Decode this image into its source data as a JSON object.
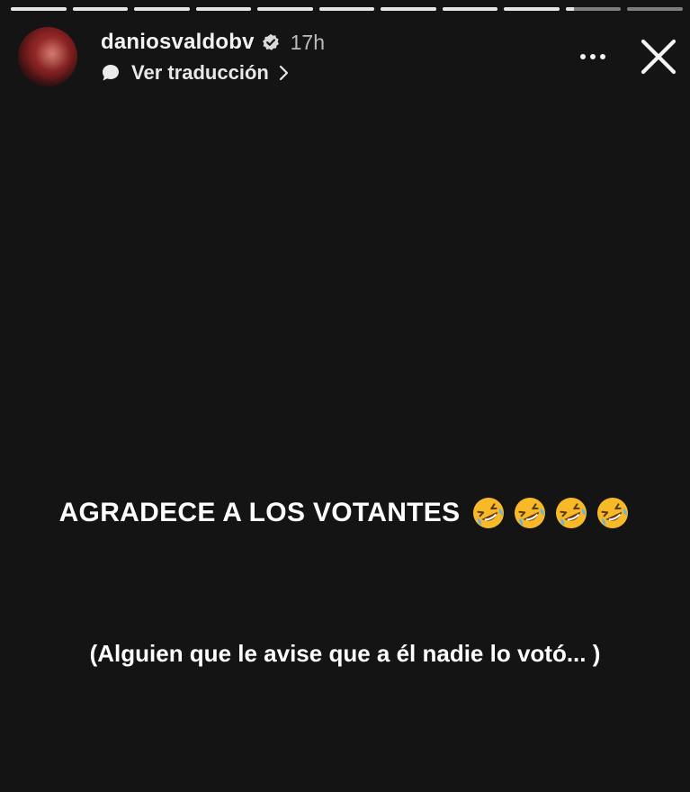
{
  "story": {
    "progress": {
      "segment_count": 11,
      "completed_segments": 9,
      "current_segment_progress": 0.15
    },
    "header": {
      "username": "daniosvaldobv",
      "verified": true,
      "time_ago": "17h",
      "translate_label": "Ver traducción"
    },
    "content": {
      "headline": "AGRADECE A LOS VOTANTES",
      "emoji_count": 4,
      "subline": "(Alguien que le avise que a él nadie lo votó... )"
    },
    "colors": {
      "background": "#141414",
      "text": "#ffffff",
      "muted": "#bdbdbd",
      "emoji_face": "#f7b928"
    },
    "icons": {
      "verified": "verified-badge-icon",
      "translate": "speech-bubble-icon",
      "more": "more-options-icon",
      "close": "close-icon",
      "chevron": "chevron-right-icon",
      "emoji": "rolling-on-floor-laughing-emoji"
    }
  }
}
